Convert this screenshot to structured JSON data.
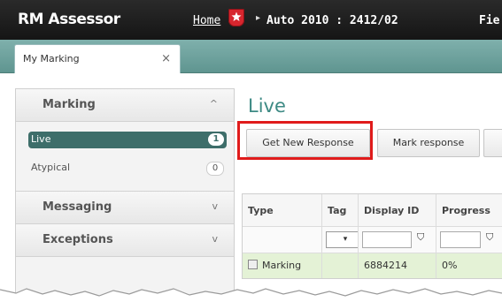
{
  "topbar": {
    "logo": "RM Assessor",
    "home_label": "Home",
    "breadcrumb_current": "Auto 2010 : 2412/02",
    "breadcrumb_more": "Fie"
  },
  "tabs": [
    {
      "label": "My Marking",
      "close": "×"
    }
  ],
  "sidebar": {
    "sections": [
      {
        "title": "Marking",
        "chevron": "^"
      },
      {
        "title": "Messaging",
        "chevron": "v"
      },
      {
        "title": "Exceptions",
        "chevron": "v"
      }
    ],
    "items": [
      {
        "label": "Live",
        "count": "1"
      },
      {
        "label": "Atypical",
        "count": "0"
      }
    ]
  },
  "main": {
    "title": "Live",
    "buttons": {
      "get_new": "Get New Response",
      "mark": "Mark response"
    }
  },
  "table": {
    "columns": [
      "Type",
      "Tag",
      "Display ID",
      "Progress"
    ],
    "filter_dropdown": "▾",
    "filter_icon": "⛉",
    "rows": [
      {
        "type": "Marking",
        "tag": "",
        "display_id": "6884214",
        "progress": "0%"
      }
    ]
  },
  "colors": {
    "accent": "#3d8a84",
    "selected_item": "#3e6e6a",
    "highlight_box": "#e01b1b",
    "row_bg": "#e4f2d6"
  }
}
